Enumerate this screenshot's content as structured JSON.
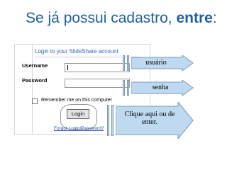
{
  "slide": {
    "title_prefix": "Se já possui cadastro, ",
    "title_bold": "entre",
    "title_suffix": ":"
  },
  "login_form": {
    "heading": "Login to your SlideShare account",
    "username_label": "Username",
    "password_label": "Password",
    "remember_label": "Remember me on this computer",
    "login_button": "Login",
    "forgot_link": "Forgot Login/Password?"
  },
  "callouts": {
    "usuario": "usuário",
    "senha": "senha",
    "login_hint": "Clique aqui ou de enter."
  }
}
